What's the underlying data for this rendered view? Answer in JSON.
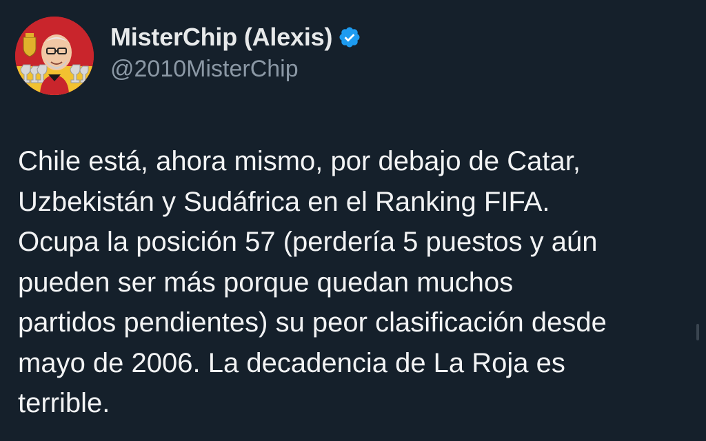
{
  "tweet": {
    "author": {
      "display_name": "MisterChip (Alexis)",
      "handle": "@2010MisterChip",
      "verified_icon": "verified-badge-icon",
      "avatar_icon": "avatar-caricature-with-trophies"
    },
    "text_lines": [
      "Chile está, ahora mismo, por debajo de Catar,",
      "Uzbekistán y Sudáfrica en el Ranking FIFA.",
      "Ocupa la posición 57 (perdería 5 puestos y aún",
      "pueden ser más porque quedan muchos",
      "partidos pendientes) su peor clasificación desde",
      "mayo de 2006. La decadencia de La Roja es",
      "terrible."
    ]
  },
  "colors": {
    "background": "#15202b",
    "text": "#f2f3f4",
    "secondary_text": "#8b98a5",
    "verified_blue": "#1d9bf0"
  }
}
